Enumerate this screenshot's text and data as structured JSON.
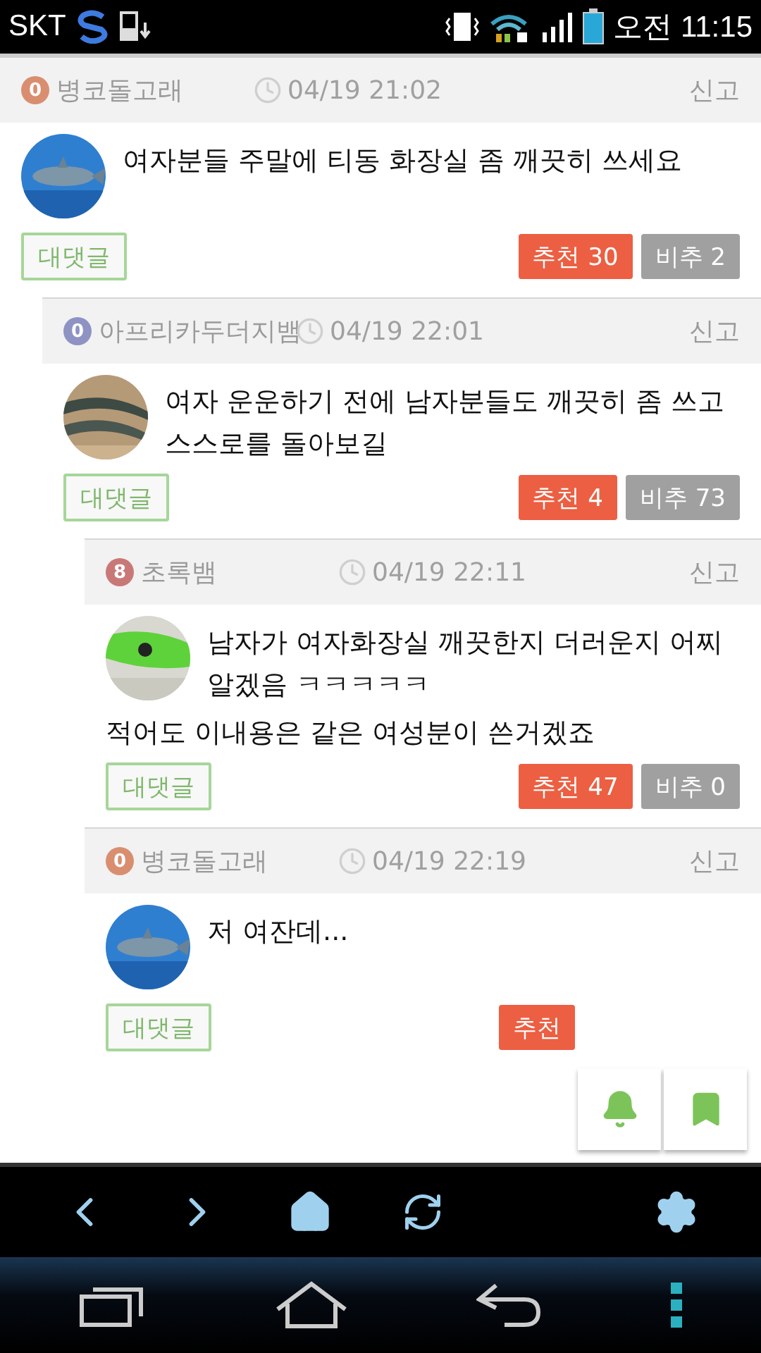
{
  "status_bar": {
    "carrier": "SKT",
    "time": "오전 11:15"
  },
  "comments": [
    {
      "level": "0",
      "color": "#d98e70",
      "author": "병코돌고래",
      "time": "04/19 21:02",
      "report": "신고",
      "body": [
        "여자분들 주말에 티동 화장실 좀 깨끗히 쓰세요"
      ],
      "reply": "대댓글",
      "up": "추천 30",
      "down": "비추 2",
      "children": [
        {
          "level": "0",
          "color": "#8e93c4",
          "author": "아프리카두더지뱀",
          "time": "04/19 22:01",
          "report": "신고",
          "body": [
            "여자 운운하기 전에 남자분들도 깨끗히 좀 쓰고 스스로를 돌아보길"
          ],
          "reply": "대댓글",
          "up": "추천 4",
          "down": "비추 73",
          "children": [
            {
              "level": "8",
              "color": "#c97878",
              "author": "초록뱀",
              "time": "04/19 22:11",
              "report": "신고",
              "body": [
                "남자가 여자화장실 깨끗한지 더러운지 어찌알겠음 ㅋㅋㅋㅋㅋ",
                "적어도 이내용은 같은 여성분이 쓴거겠죠"
              ],
              "reply": "대댓글",
              "up": "추천 47",
              "down": "비추 0"
            },
            {
              "level": "0",
              "color": "#d98e70",
              "author": "병코돌고래",
              "time": "04/19 22:19",
              "report": "신고",
              "body": [
                "저 여잔데..."
              ],
              "reply": "대댓글",
              "up": "추천"
            }
          ]
        }
      ]
    }
  ]
}
